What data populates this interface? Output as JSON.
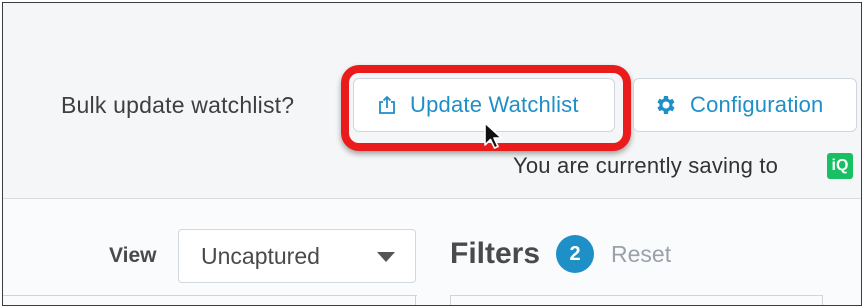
{
  "header": {
    "bulk_label": "Bulk update watchlist?",
    "update_button_label": "Update Watchlist",
    "update_icon": "share-upload-icon",
    "config_button_label": "Configuration",
    "config_icon": "gear-icon",
    "saving_text": "You are currently saving to",
    "saving_badge": "iQ",
    "accent_color": "#1f8fc8",
    "highlight_color": "#ea1b1b",
    "badge_color": "#18c063"
  },
  "filters_panel": {
    "view_label": "View",
    "view_selected": "Uncaptured",
    "filters_title": "Filters",
    "filters_count": "2",
    "reset_label": "Reset"
  }
}
